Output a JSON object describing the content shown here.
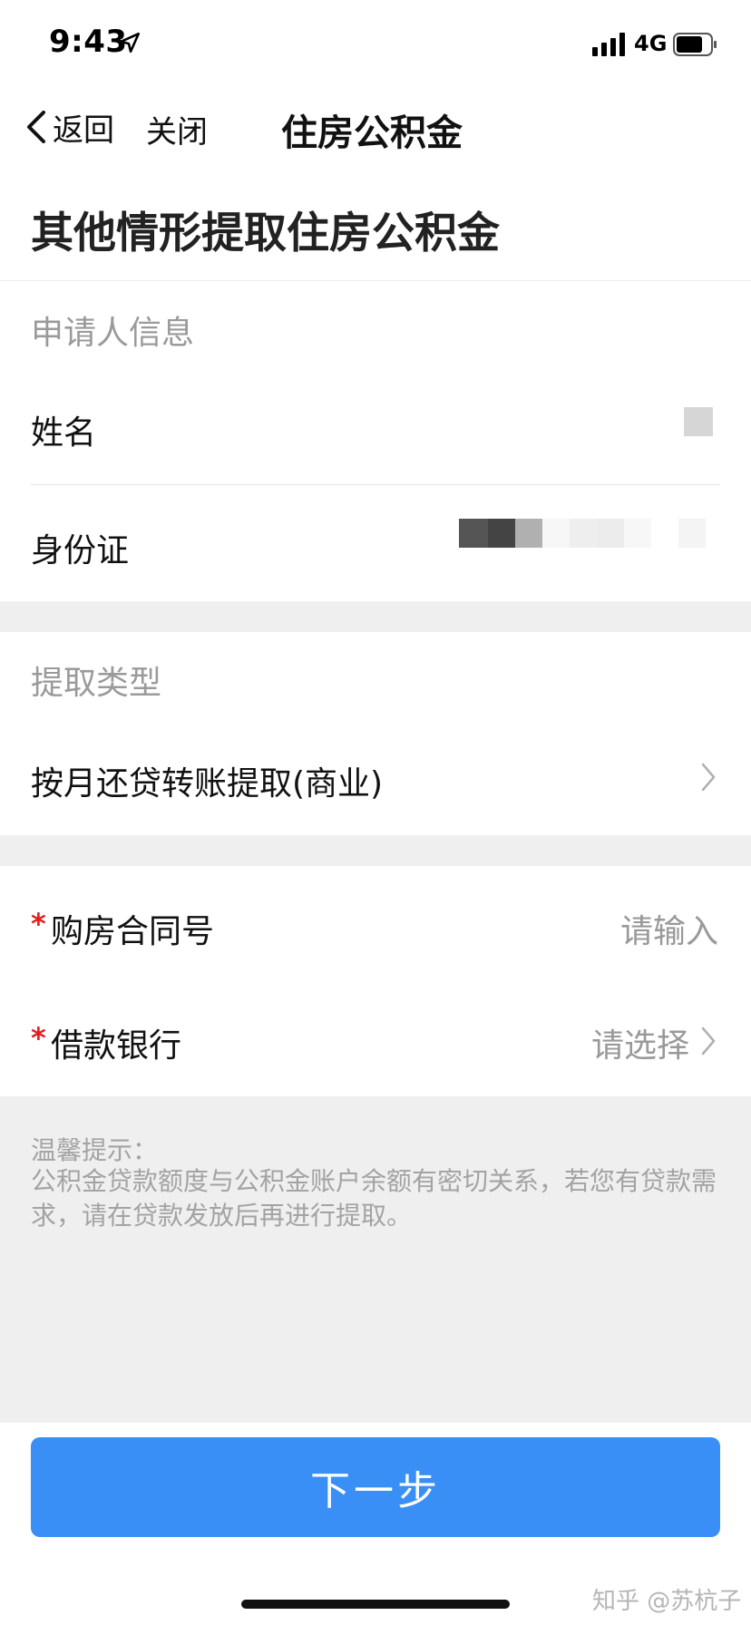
{
  "status_bar": {
    "time": "9:43",
    "network": "4G",
    "icons": [
      "location-arrow-icon",
      "signal-icon",
      "battery-icon"
    ]
  },
  "nav": {
    "back_label": "返回",
    "close_label": "关闭",
    "title": "住房公积金"
  },
  "page": {
    "title": "其他情形提取住房公积金"
  },
  "applicant": {
    "header": "申请人信息",
    "name_label": "姓名",
    "id_label": "身份证"
  },
  "withdraw_type": {
    "header": "提取类型",
    "selected": "按月还贷转账提取(商业)"
  },
  "form": {
    "contract_label": "购房合同号",
    "contract_placeholder": "请输入",
    "bank_label": "借款银行",
    "bank_placeholder": "请选择",
    "required_mark": "*"
  },
  "tips": {
    "title": "温馨提示：",
    "body": "公积金贷款额度与公积金账户余额有密切关系，若您有贷款需求，请在贷款发放后再进行提取。"
  },
  "actions": {
    "next_label": "下一步"
  },
  "watermark": "知乎 @苏杭子",
  "colors": {
    "primary": "#3a8ff7",
    "required": "#e02020",
    "section_gap": "#efefef"
  }
}
